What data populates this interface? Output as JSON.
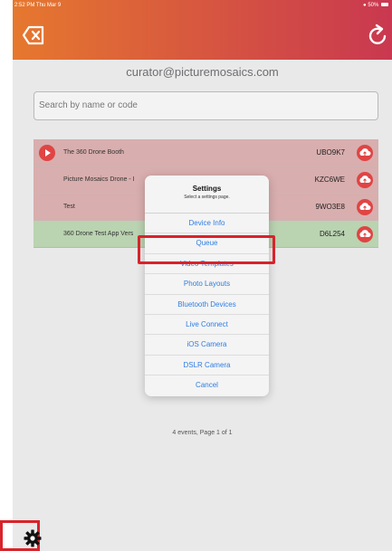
{
  "status_bar": {
    "time_date": "2:52 PM  Thu Mar 9",
    "battery": "50%"
  },
  "header": {
    "back_icon": "clear-backspace-icon",
    "refresh_icon": "refresh-icon"
  },
  "account": {
    "email": "curator@picturemosaics.com"
  },
  "search": {
    "placeholder": "Search by name or code"
  },
  "events": [
    {
      "name": "The 360 Drone Booth",
      "code": "UBO9K7",
      "status": "red",
      "has_play": true
    },
    {
      "name": "Picture Mosaics Drone - I",
      "code": "KZC6WE",
      "status": "red",
      "has_play": false
    },
    {
      "name": "Test",
      "code": "9WO3E8",
      "status": "red",
      "has_play": false
    },
    {
      "name": "360 Drone Test App Vers",
      "code": "D6L254",
      "status": "green",
      "has_play": false
    }
  ],
  "page_info": "4 events, Page 1 of 1",
  "modal": {
    "title": "Settings",
    "subtitle": "Select a settings page.",
    "options": [
      "Device Info",
      "Queue",
      "Video Templates",
      "Photo Layouts",
      "Bluetooth Devices",
      "Live Connect",
      "iOS Camera",
      "DSLR Camera",
      "Cancel"
    ],
    "highlighted_option": "Live Connect"
  },
  "colors": {
    "accent": "#2f7de1",
    "highlight": "#d8232a",
    "header_start": "#e6782e",
    "header_end": "#c93850"
  }
}
